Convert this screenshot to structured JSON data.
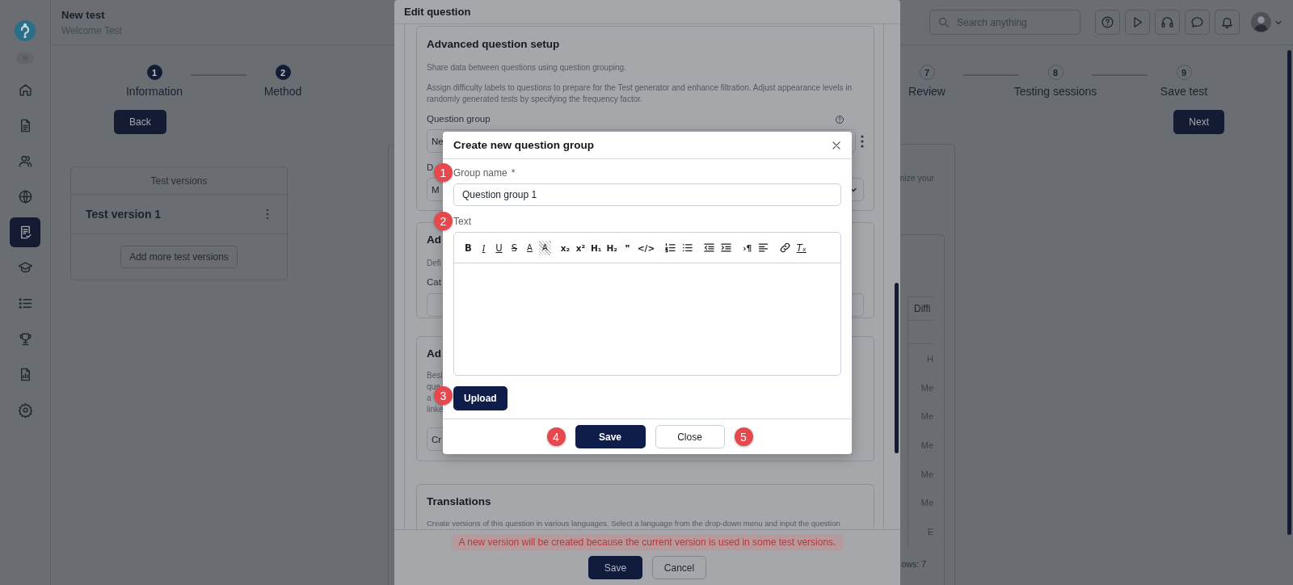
{
  "sidebar": {
    "items": [
      {
        "kind": "home",
        "selected": false
      },
      {
        "kind": "document",
        "selected": false
      },
      {
        "kind": "users",
        "selected": false
      },
      {
        "kind": "globe",
        "selected": false
      },
      {
        "kind": "tests",
        "selected": true
      },
      {
        "kind": "graduation",
        "selected": false
      },
      {
        "kind": "list",
        "selected": false
      },
      {
        "kind": "trophy",
        "selected": false
      },
      {
        "kind": "report",
        "selected": false
      },
      {
        "kind": "settings",
        "selected": false
      }
    ]
  },
  "header": {
    "title": "New test",
    "subtitle": "Welcome Test",
    "search": {
      "placeholder": "Search anything"
    },
    "actions": [
      {
        "kind": "help"
      },
      {
        "kind": "play"
      },
      {
        "kind": "headset"
      },
      {
        "kind": "chat"
      },
      {
        "kind": "bell"
      }
    ]
  },
  "stepper": {
    "start": [
      {
        "number": "1",
        "label": "Information",
        "completed": true
      },
      {
        "number": "2",
        "label": "Method",
        "completed": true
      }
    ],
    "end": [
      {
        "number": "7",
        "label": "Review",
        "completed": false
      },
      {
        "number": "8",
        "label": "Testing sessions",
        "completed": false
      },
      {
        "number": "9",
        "label": "Save test",
        "completed": false
      }
    ],
    "back_button": "Back",
    "next_button": "Next"
  },
  "test_versions": {
    "title": "Test versions",
    "items": [
      {
        "name": "Test version 1"
      }
    ],
    "add_button": "Add more test versions"
  },
  "background_panel": {
    "text": "nize your",
    "table": {
      "column": "Diffi",
      "cells": [
        "H",
        "Me",
        "Me",
        "Me",
        "Me",
        "Me",
        "E"
      ],
      "footer": "ows: 7"
    }
  },
  "edit_question": {
    "title": "Edit question",
    "section_1": {
      "title": "Advanced question setup",
      "paragraphs": [
        "Share data between questions using question grouping.",
        "Assign difficulty labels to questions to prepare for the Test generator and enhance filtration. Adjust appearance levels in randomly generated tests by specifying the frequency factor."
      ],
      "field_1_label": "Question group",
      "field_1_value": "Ne",
      "field_2_label": "D",
      "field_2_value": "M"
    },
    "section_2": {
      "title": "Ad",
      "description": "Defi",
      "field_label": "Cat"
    },
    "section_3": {
      "title": "Ad",
      "lines": [
        "Besi",
        "que",
        "a",
        "linke"
      ],
      "button": "Cr"
    },
    "section_4": {
      "title": "Translations",
      "description": "Create versions of this question in various languages. Select a language from the drop-down menu and input the question"
    },
    "notice": "A new version will be created because the current version is used in some test versions.",
    "save_button": "Save",
    "cancel_button": "Cancel"
  },
  "create_group_dialog": {
    "title": "Create new question group",
    "name_label": "Group name",
    "required_mark": "*",
    "name_value": "Question group 1",
    "name_marker": "1",
    "text_label": "Text",
    "text_marker": "2",
    "toolbar": [
      {
        "kind": "bold",
        "label": "B"
      },
      {
        "kind": "italic",
        "label": "I"
      },
      {
        "kind": "underline",
        "label": "U"
      },
      {
        "kind": "strike",
        "label": "S"
      },
      {
        "kind": "color",
        "label": "A"
      },
      {
        "kind": "highlight",
        "label": "A"
      },
      {
        "kind": "plain",
        "label": "x₂"
      },
      {
        "kind": "plain",
        "label": "x²"
      },
      {
        "kind": "plain",
        "label": "H₁"
      },
      {
        "kind": "plain",
        "label": "H₂"
      },
      {
        "kind": "plain",
        "label": "❞"
      },
      {
        "kind": "plain",
        "label": "</>"
      },
      {
        "kind": "ordered-list"
      },
      {
        "kind": "bullet-list"
      },
      {
        "kind": "outdent"
      },
      {
        "kind": "indent"
      },
      {
        "kind": "plain",
        "label": "›¶"
      },
      {
        "kind": "align"
      },
      {
        "kind": "link"
      },
      {
        "kind": "clear",
        "label": "Tₓ"
      }
    ],
    "upload_button": "Upload",
    "upload_marker": "3",
    "save_button": "Save",
    "save_marker": "4",
    "close_button": "Close",
    "close_marker": "5"
  }
}
